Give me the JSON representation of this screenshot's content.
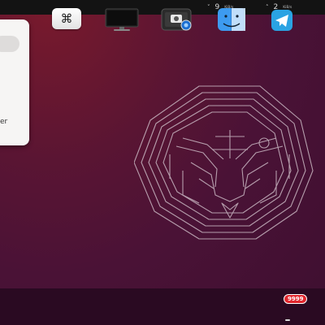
{
  "top_bar": {
    "download_value": "9",
    "download_unit": "KiB/s",
    "upload_value": "2",
    "upload_unit": "KiB/s"
  },
  "popup": {
    "partial_text": "er"
  },
  "dock": {
    "apps": [
      {
        "name": "command-keys-app-icon"
      },
      {
        "name": "monitor-app-icon"
      },
      {
        "name": "screenshot-app-icon"
      },
      {
        "name": "finder-app-icon"
      },
      {
        "name": "telegram-app-icon"
      }
    ],
    "telegram_badge": "9999"
  },
  "colors": {
    "wallpaper": "#4a1236",
    "dock": "#2a0a22",
    "topbar": "#131313",
    "badge": "#e0262d"
  }
}
